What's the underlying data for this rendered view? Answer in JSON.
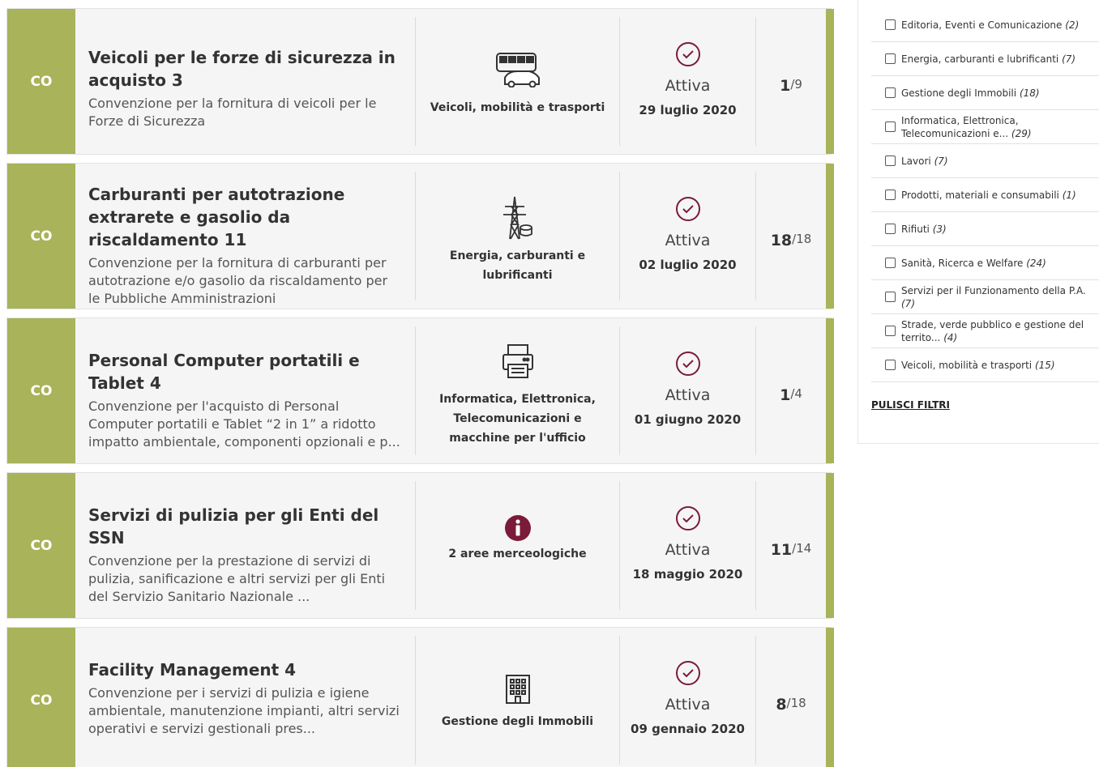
{
  "badge_label": "CO",
  "colors": {
    "accent": "#a8b35a",
    "brand": "#7a1b3a"
  },
  "cards": [
    {
      "title": "Veicoli per le forze di sicurezza in acquisto 3",
      "description": "Convenzione per la fornitura di veicoli per le Forze di Sicurezza",
      "category_icon": "vehicle-icon",
      "category": "Veicoli, mobilità e trasporti",
      "status": "Attiva",
      "date": "29 luglio 2020",
      "count_current": "1",
      "count_total": "/9"
    },
    {
      "title": "Carburanti per autotrazione extrarete e gasolio da riscaldamento 11",
      "description": "Convenzione per la fornitura di carburanti per autotrazione e/o gasolio da riscaldamento per le Pubbliche Amministrazioni",
      "category_icon": "energy-pylon-icon",
      "category": "Energia, carburanti e lubrificanti",
      "status": "Attiva",
      "date": "02 luglio 2020",
      "count_current": "18",
      "count_total": "/18"
    },
    {
      "title": "Personal Computer portatili e Tablet 4",
      "description": "Convenzione per l'acquisto di Personal Computer portatili e Tablet “2 in 1” a ridotto impatto ambientale, componenti opzionali e p...",
      "category_icon": "printer-icon",
      "category": "Informatica, Elettronica, Telecomunicazioni e macchine per l'ufficio",
      "status": "Attiva",
      "date": "01 giugno 2020",
      "count_current": "1",
      "count_total": "/4"
    },
    {
      "title": "Servizi di pulizia per gli Enti del SSN",
      "description": "Convenzione per la prestazione di servizi di pulizia, sanificazione e altri servizi per gli Enti del Servizio Sanitario Nazionale ...",
      "category_icon": "info-icon",
      "category": "2 aree merceologiche",
      "status": "Attiva",
      "date": "18 maggio 2020",
      "count_current": "11",
      "count_total": "/14"
    },
    {
      "title": "Facility Management 4",
      "description": "Convenzione per i servizi di pulizia e igiene ambientale, manutenzione impianti, altri servizi operativi e servizi gestionali pres...",
      "category_icon": "building-icon",
      "category": "Gestione degli Immobili",
      "status": "Attiva",
      "date": "09 gennaio 2020",
      "count_current": "8",
      "count_total": "/18"
    }
  ],
  "filters": [
    {
      "label": "Editoria, Eventi e Comunicazione",
      "count": "(2)"
    },
    {
      "label": "Energia, carburanti e lubrificanti",
      "count": "(7)"
    },
    {
      "label": "Gestione degli Immobili",
      "count": "(18)"
    },
    {
      "label": "Informatica, Elettronica, Telecomunicazioni e...",
      "count": "(29)"
    },
    {
      "label": "Lavori",
      "count": "(7)"
    },
    {
      "label": "Prodotti, materiali e consumabili",
      "count": "(1)"
    },
    {
      "label": "Rifiuti",
      "count": "(3)"
    },
    {
      "label": "Sanità, Ricerca e Welfare",
      "count": "(24)"
    },
    {
      "label": "Servizi per il Funzionamento della P.A.",
      "count": "(7)"
    },
    {
      "label": "Strade, verde pubblico e gestione del territo...",
      "count": "(4)"
    },
    {
      "label": "Veicoli, mobilità e trasporti",
      "count": "(15)"
    }
  ],
  "clear_filters": "PULISCI FILTRI"
}
